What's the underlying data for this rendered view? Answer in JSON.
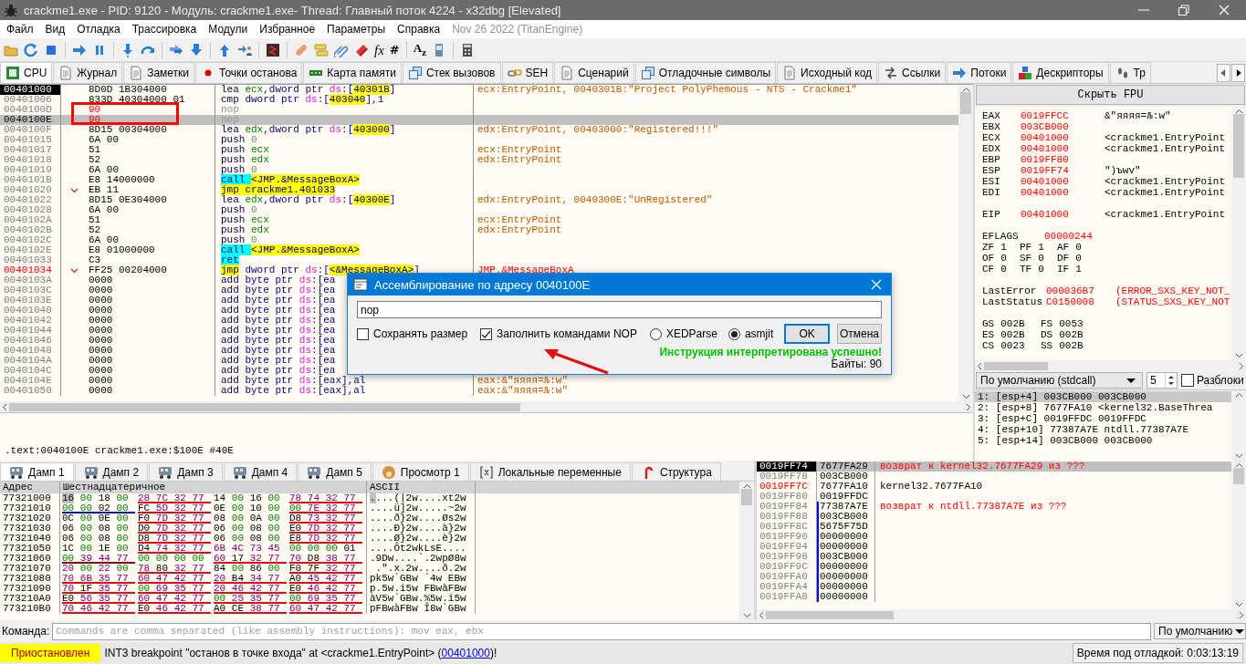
{
  "window": {
    "title": "crackme1.exe - PID: 9120 - Модуль: crackme1.exe- Thread: Главный поток 4224 - x32dbg [Elevated]"
  },
  "menu": {
    "items": [
      "Файл",
      "Вид",
      "Отладка",
      "Трассировка",
      "Модули",
      "Избранное",
      "Параметры",
      "Справка"
    ],
    "build_info": "Nov 26 2022 (TitanEngine)"
  },
  "toolbar": {
    "glyphs": [
      "fx",
      "#",
      "A$_{z}$"
    ]
  },
  "tabs": [
    {
      "label": "CPU",
      "selected": true
    },
    {
      "label": "Журнал",
      "selected": false
    },
    {
      "label": "Заметки",
      "selected": false
    },
    {
      "label": "Точки останова",
      "selected": false
    },
    {
      "label": "Карта памяти",
      "selected": false
    },
    {
      "label": "Стек вызовов",
      "selected": false
    },
    {
      "label": "SEH",
      "selected": false
    },
    {
      "label": "Сценарий",
      "selected": false
    },
    {
      "label": "Отладочные символы",
      "selected": false
    },
    {
      "label": "Исходный код",
      "selected": false
    },
    {
      "label": "Ссылки",
      "selected": false
    },
    {
      "label": "Потоки",
      "selected": false
    },
    {
      "label": "Дескрипторы",
      "selected": false
    },
    {
      "label": "Тр",
      "selected": false
    }
  ],
  "disasm": {
    "rows": [
      {
        "address": {
          "text": "00401000",
          "kind": "eip"
        },
        "jump": false,
        "bytes": "8D0D 1B304000",
        "bytes_modified": false,
        "selected": false,
        "instruction": [
          {
            "kind": "op",
            "text": "lea "
          },
          {
            "kind": "reg",
            "text": "ecx"
          },
          {
            "kind": "txt",
            "text": ",dword ptr "
          },
          {
            "kind": "seg",
            "text": "ds"
          },
          {
            "kind": "txt",
            "text": ":["
          },
          {
            "kind": "mem",
            "text": "40301B"
          },
          {
            "kind": "txt",
            "text": "]"
          }
        ],
        "comment": {
          "text": "ecx:EntryPoint, 0040301B:\"Project PolyPhemous - NTS - Crackme1\"",
          "kind": "auto"
        }
      },
      {
        "address": {
          "text": "00401006",
          "kind": "plain"
        },
        "jump": false,
        "bytes": "833D 40304000 01",
        "bytes_modified": false,
        "selected": false,
        "instruction": [
          {
            "kind": "op",
            "text": "cmp "
          },
          {
            "kind": "txt",
            "text": "dword ptr "
          },
          {
            "kind": "seg",
            "text": "ds"
          },
          {
            "kind": "txt",
            "text": ":["
          },
          {
            "kind": "mem",
            "text": "403040"
          },
          {
            "kind": "txt",
            "text": "],1"
          }
        ]
      },
      {
        "address": {
          "text": "0040100D",
          "kind": "plain"
        },
        "jump": false,
        "bytes": "90",
        "bytes_modified": true,
        "selected": false,
        "instruction": [
          {
            "kind": "dim",
            "text": "nop"
          }
        ]
      },
      {
        "address": {
          "text": "0040100E",
          "kind": "plain"
        },
        "jump": false,
        "bytes": "90",
        "bytes_modified": true,
        "selected": true,
        "instruction": [
          {
            "kind": "dim",
            "text": "nop"
          }
        ]
      },
      {
        "address": {
          "text": "0040100F",
          "kind": "plain"
        },
        "jump": false,
        "bytes": "8D15 00304000",
        "bytes_modified": false,
        "selected": false,
        "instruction": [
          {
            "kind": "op",
            "text": "lea "
          },
          {
            "kind": "reg",
            "text": "edx"
          },
          {
            "kind": "txt",
            "text": ",dword ptr "
          },
          {
            "kind": "seg",
            "text": "ds"
          },
          {
            "kind": "txt",
            "text": ":["
          },
          {
            "kind": "mem",
            "text": "403000"
          },
          {
            "kind": "txt",
            "text": "]"
          }
        ],
        "comment": {
          "text": "edx:EntryPoint, 00403000:\"Registered!!!\"",
          "kind": "auto"
        }
      },
      {
        "address": {
          "text": "00401015",
          "kind": "plain"
        },
        "jump": false,
        "bytes": "6A 00",
        "bytes_modified": false,
        "selected": false,
        "instruction": [
          {
            "kind": "op",
            "text": "push "
          },
          {
            "kind": "num",
            "text": "0"
          }
        ]
      },
      {
        "address": {
          "text": "00401017",
          "kind": "plain"
        },
        "jump": false,
        "bytes": "51",
        "bytes_modified": false,
        "selected": false,
        "instruction": [
          {
            "kind": "op",
            "text": "push "
          },
          {
            "kind": "reg",
            "text": "ecx"
          }
        ],
        "comment": {
          "text": "ecx:EntryPoint",
          "kind": "auto"
        }
      },
      {
        "address": {
          "text": "00401018",
          "kind": "plain"
        },
        "jump": false,
        "bytes": "52",
        "bytes_modified": false,
        "selected": false,
        "instruction": [
          {
            "kind": "op",
            "text": "push "
          },
          {
            "kind": "reg",
            "text": "edx"
          }
        ],
        "comment": {
          "text": "edx:EntryPoint",
          "kind": "auto"
        }
      },
      {
        "address": {
          "text": "00401019",
          "kind": "plain"
        },
        "jump": false,
        "bytes": "6A 00",
        "bytes_modified": false,
        "selected": false,
        "instruction": [
          {
            "kind": "op",
            "text": "push "
          },
          {
            "kind": "num",
            "text": "0"
          }
        ]
      },
      {
        "address": {
          "text": "0040101B",
          "kind": "plain"
        },
        "jump": false,
        "bytes": "E8 14000000",
        "bytes_modified": false,
        "selected": false,
        "instruction": [
          {
            "kind": "call",
            "text": "call "
          },
          {
            "kind": "sym",
            "text": "<JMP.&MessageBoxA>"
          }
        ]
      },
      {
        "address": {
          "text": "00401020",
          "kind": "plain"
        },
        "jump": true,
        "bytes": "EB 11",
        "bytes_modified": false,
        "selected": false,
        "instruction": [
          {
            "kind": "jmp",
            "text": "jmp "
          },
          {
            "kind": "sym",
            "text": "crackme1.401033"
          }
        ]
      },
      {
        "address": {
          "text": "00401022",
          "kind": "plain"
        },
        "jump": false,
        "bytes": "8D15 0E304000",
        "bytes_modified": false,
        "selected": false,
        "instruction": [
          {
            "kind": "op",
            "text": "lea "
          },
          {
            "kind": "reg",
            "text": "edx"
          },
          {
            "kind": "txt",
            "text": ",dword ptr "
          },
          {
            "kind": "seg",
            "text": "ds"
          },
          {
            "kind": "txt",
            "text": ":["
          },
          {
            "kind": "mem",
            "text": "40300E"
          },
          {
            "kind": "txt",
            "text": "]"
          }
        ],
        "comment": {
          "text": "edx:EntryPoint, 0040300E:\"UnRegistered\"",
          "kind": "auto"
        }
      },
      {
        "address": {
          "text": "00401028",
          "kind": "plain"
        },
        "jump": false,
        "bytes": "6A 00",
        "bytes_modified": false,
        "selected": false,
        "instruction": [
          {
            "kind": "op",
            "text": "push "
          },
          {
            "kind": "num",
            "text": "0"
          }
        ]
      },
      {
        "address": {
          "text": "0040102A",
          "kind": "plain"
        },
        "jump": false,
        "bytes": "51",
        "bytes_modified": false,
        "selected": false,
        "instruction": [
          {
            "kind": "op",
            "text": "push "
          },
          {
            "kind": "reg",
            "text": "ecx"
          }
        ],
        "comment": {
          "text": "ecx:EntryPoint",
          "kind": "auto"
        }
      },
      {
        "address": {
          "text": "0040102B",
          "kind": "plain"
        },
        "jump": false,
        "bytes": "52",
        "bytes_modified": false,
        "selected": false,
        "instruction": [
          {
            "kind": "op",
            "text": "push "
          },
          {
            "kind": "reg",
            "text": "edx"
          }
        ],
        "comment": {
          "text": "edx:EntryPoint",
          "kind": "auto"
        }
      },
      {
        "address": {
          "text": "0040102C",
          "kind": "plain"
        },
        "jump": false,
        "bytes": "6A 00",
        "bytes_modified": false,
        "selected": false,
        "instruction": [
          {
            "kind": "op",
            "text": "push "
          },
          {
            "kind": "num",
            "text": "0"
          }
        ]
      },
      {
        "address": {
          "text": "0040102E",
          "kind": "plain"
        },
        "jump": false,
        "bytes": "E8 01000000",
        "bytes_modified": false,
        "selected": false,
        "instruction": [
          {
            "kind": "call",
            "text": "call "
          },
          {
            "kind": "sym",
            "text": "<JMP.&MessageBoxA>"
          }
        ]
      },
      {
        "address": {
          "text": "00401033",
          "kind": "plain"
        },
        "jump": false,
        "bytes": "C3",
        "bytes_modified": false,
        "selected": false,
        "instruction": [
          {
            "kind": "call",
            "text": "ret"
          }
        ]
      },
      {
        "address": {
          "text": "00401034",
          "kind": "label"
        },
        "jump": true,
        "bytes": "FF25 00204000",
        "bytes_modified": false,
        "selected": false,
        "instruction": [
          {
            "kind": "jmp",
            "text": "jmp"
          },
          {
            "kind": "txt",
            "text": " dword ptr "
          },
          {
            "kind": "seg",
            "text": "ds"
          },
          {
            "kind": "txt",
            "text": ":["
          },
          {
            "kind": "sym",
            "text": "<&MessageBoxA>"
          },
          {
            "kind": "txt",
            "text": "]"
          }
        ],
        "comment": {
          "text": "JMP.&MessageBoxA",
          "kind": "label"
        }
      },
      {
        "address": {
          "text": "0040103A",
          "kind": "plain"
        },
        "jump": false,
        "bytes": "0000",
        "bytes_modified": false,
        "selected": false,
        "instruction": [
          {
            "kind": "op",
            "text": "add "
          },
          {
            "kind": "txt",
            "text": "byte ptr "
          },
          {
            "kind": "seg",
            "text": "ds"
          },
          {
            "kind": "txt",
            "text": ":[ea"
          }
        ]
      },
      {
        "address": {
          "text": "0040103C",
          "kind": "plain"
        },
        "jump": false,
        "bytes": "0000",
        "bytes_modified": false,
        "selected": false,
        "instruction": [
          {
            "kind": "op",
            "text": "add "
          },
          {
            "kind": "txt",
            "text": "byte ptr "
          },
          {
            "kind": "seg",
            "text": "ds"
          },
          {
            "kind": "txt",
            "text": ":[ea"
          }
        ]
      },
      {
        "address": {
          "text": "0040103E",
          "kind": "plain"
        },
        "jump": false,
        "bytes": "0000",
        "bytes_modified": false,
        "selected": false,
        "instruction": [
          {
            "kind": "op",
            "text": "add "
          },
          {
            "kind": "txt",
            "text": "byte ptr "
          },
          {
            "kind": "seg",
            "text": "ds"
          },
          {
            "kind": "txt",
            "text": ":[ea"
          }
        ]
      },
      {
        "address": {
          "text": "00401040",
          "kind": "plain"
        },
        "jump": false,
        "bytes": "0000",
        "bytes_modified": false,
        "selected": false,
        "instruction": [
          {
            "kind": "op",
            "text": "add "
          },
          {
            "kind": "txt",
            "text": "byte ptr "
          },
          {
            "kind": "seg",
            "text": "ds"
          },
          {
            "kind": "txt",
            "text": ":[ea"
          }
        ]
      },
      {
        "address": {
          "text": "00401042",
          "kind": "plain"
        },
        "jump": false,
        "bytes": "0000",
        "bytes_modified": false,
        "selected": false,
        "instruction": [
          {
            "kind": "op",
            "text": "add "
          },
          {
            "kind": "txt",
            "text": "byte ptr "
          },
          {
            "kind": "seg",
            "text": "ds"
          },
          {
            "kind": "txt",
            "text": ":[ea"
          }
        ]
      },
      {
        "address": {
          "text": "00401044",
          "kind": "plain"
        },
        "jump": false,
        "bytes": "0000",
        "bytes_modified": false,
        "selected": false,
        "instruction": [
          {
            "kind": "op",
            "text": "add "
          },
          {
            "kind": "txt",
            "text": "byte ptr "
          },
          {
            "kind": "seg",
            "text": "ds"
          },
          {
            "kind": "txt",
            "text": ":[ea"
          }
        ]
      },
      {
        "address": {
          "text": "00401046",
          "kind": "plain"
        },
        "jump": false,
        "bytes": "0000",
        "bytes_modified": false,
        "selected": false,
        "instruction": [
          {
            "kind": "op",
            "text": "add "
          },
          {
            "kind": "txt",
            "text": "byte ptr "
          },
          {
            "kind": "seg",
            "text": "ds"
          },
          {
            "kind": "txt",
            "text": ":[ea"
          }
        ]
      },
      {
        "address": {
          "text": "00401048",
          "kind": "plain"
        },
        "jump": false,
        "bytes": "0000",
        "bytes_modified": false,
        "selected": false,
        "instruction": [
          {
            "kind": "op",
            "text": "add "
          },
          {
            "kind": "txt",
            "text": "byte ptr "
          },
          {
            "kind": "seg",
            "text": "ds"
          },
          {
            "kind": "txt",
            "text": ":[ea"
          }
        ]
      },
      {
        "address": {
          "text": "0040104A",
          "kind": "plain"
        },
        "jump": false,
        "bytes": "0000",
        "bytes_modified": false,
        "selected": false,
        "instruction": [
          {
            "kind": "op",
            "text": "add "
          },
          {
            "kind": "txt",
            "text": "byte ptr "
          },
          {
            "kind": "seg",
            "text": "ds"
          },
          {
            "kind": "txt",
            "text": ":[ea"
          }
        ]
      },
      {
        "address": {
          "text": "0040104C",
          "kind": "plain"
        },
        "jump": false,
        "bytes": "0000",
        "bytes_modified": false,
        "selected": false,
        "instruction": [
          {
            "kind": "op",
            "text": "add "
          },
          {
            "kind": "txt",
            "text": "byte ptr "
          },
          {
            "kind": "seg",
            "text": "ds"
          },
          {
            "kind": "txt",
            "text": ":[ea"
          }
        ]
      },
      {
        "address": {
          "text": "0040104E",
          "kind": "plain"
        },
        "jump": false,
        "bytes": "0000",
        "bytes_modified": false,
        "selected": false,
        "instruction": [
          {
            "kind": "op",
            "text": "add "
          },
          {
            "kind": "txt",
            "text": "byte ptr "
          },
          {
            "kind": "seg",
            "text": "ds"
          },
          {
            "kind": "txt",
            "text": ":[eax],al"
          }
        ],
        "comment": {
          "text": "eax:&\"яяяя=Љ:w\"",
          "kind": "auto"
        }
      },
      {
        "address": {
          "text": "00401050",
          "kind": "plain"
        },
        "jump": false,
        "bytes": "0000",
        "bytes_modified": false,
        "selected": false,
        "instruction": [
          {
            "kind": "op",
            "text": "add "
          },
          {
            "kind": "txt",
            "text": "byte ptr "
          },
          {
            "kind": "seg",
            "text": "ds"
          },
          {
            "kind": "txt",
            "text": ":[eax],al"
          }
        ],
        "comment": {
          "text": "eax:&\"яяяя=Љ:w\"",
          "kind": "auto"
        }
      }
    ],
    "info": ".text:0040100E crackme1.exe:$100E #40E"
  },
  "dialog": {
    "title": "Ассемблирование по адресу 0040100E",
    "value": "nop",
    "checkboxes": [
      {
        "label": "Сохранять размер",
        "checked": false
      },
      {
        "label": "Заполнить командами NOP",
        "checked": true
      }
    ],
    "radios": [
      {
        "label": "XEDParse",
        "selected": false
      },
      {
        "label": "asmjit",
        "selected": true
      }
    ],
    "buttons": [
      {
        "label": "OK",
        "default": true
      },
      {
        "label": "Отмена",
        "default": false
      }
    ],
    "status": "Инструкция интерпретирована успешно!",
    "bytes": "Байты: 90"
  },
  "annotations": {
    "frame": true,
    "arrow": true
  },
  "registers": {
    "button": "Скрыть FPU",
    "groups": [
      [
        {
          "kind": "reg",
          "name": "EAX",
          "value": "0019FFCC",
          "info": "&\"яяяя=Љ:w\""
        },
        {
          "kind": "reg",
          "name": "EBX",
          "value": "003CB000"
        },
        {
          "kind": "reg",
          "name": "ECX",
          "value": "00401000",
          "info": "<crackme1.EntryPoint"
        },
        {
          "kind": "reg",
          "name": "EDX",
          "value": "00401000",
          "info": "<crackme1.EntryPoint"
        },
        {
          "kind": "reg",
          "name": "EBP",
          "value": "0019FF80"
        },
        {
          "kind": "reg",
          "name": "ESP",
          "value": "0019FF74",
          "info": "\")ъwv\""
        },
        {
          "kind": "reg",
          "name": "ESI",
          "value": "00401000",
          "info": "<crackme1.EntryPoint"
        },
        {
          "kind": "reg",
          "name": "EDI",
          "value": "00401000",
          "info": "<crackme1.EntryPoint"
        }
      ],
      [
        {
          "kind": "reg",
          "name": "EIP",
          "value": "00401000",
          "info": "<crackme1.EntryPoint"
        }
      ],
      [
        {
          "kind": "eflags",
          "name": "EFLAGS",
          "value": "00000244"
        },
        {
          "kind": "flags",
          "items": [
            {
              "name": "ZF",
              "value": "1"
            },
            {
              "name": "PF",
              "value": "1"
            },
            {
              "name": "AF",
              "value": "0"
            }
          ]
        },
        {
          "kind": "flags",
          "items": [
            {
              "name": "OF",
              "value": "0"
            },
            {
              "name": "SF",
              "value": "0"
            },
            {
              "name": "DF",
              "value": "0"
            }
          ]
        },
        {
          "kind": "flags",
          "items": [
            {
              "name": "CF",
              "value": "0"
            },
            {
              "name": "TF",
              "value": "0"
            },
            {
              "name": "IF",
              "value": "1"
            }
          ]
        }
      ],
      [
        {
          "kind": "error",
          "name": "LastError",
          "value": "000036B7",
          "info": "(ERROR_SXS_KEY_NOT_"
        },
        {
          "kind": "error",
          "name": "LastStatus",
          "value": "C0150008",
          "info": "(STATUS_SXS_KEY_NOT"
        }
      ],
      [
        {
          "kind": "segments",
          "items": [
            {
              "name": "GS",
              "value": "002B"
            },
            {
              "name": "FS",
              "value": "0053"
            }
          ]
        },
        {
          "kind": "segments",
          "items": [
            {
              "name": "ES",
              "value": "002B"
            },
            {
              "name": "DS",
              "value": "002B"
            }
          ]
        },
        {
          "kind": "segments",
          "items": [
            {
              "name": "CS",
              "value": "0023"
            },
            {
              "name": "SS",
              "value": "002B"
            }
          ]
        }
      ]
    ]
  },
  "call_args": {
    "convention": "По умолчанию (stdcall)",
    "count": "5",
    "unlock": {
      "label": "Разблоки",
      "checked": false
    },
    "lines": [
      {
        "text": "1: [esp+4] 003CB000 003CB000",
        "selected": true
      },
      {
        "text": "2: [esp+8] 7677FA10 <kernel32.BaseThrea",
        "selected": false
      },
      {
        "text": "3: [esp+C] 0019FFDC 0019FFDC",
        "selected": false
      },
      {
        "text": "4: [esp+10] 77387A7E ntdll.77387A7E",
        "selected": false
      },
      {
        "text": "5: [esp+14] 003CB000 003CB000",
        "selected": false
      }
    ]
  },
  "dump_tabs": [
    {
      "label": "Дамп 1",
      "selected": true
    },
    {
      "label": "Дамп 2",
      "selected": false
    },
    {
      "label": "Дамп 3",
      "selected": false
    },
    {
      "label": "Дамп 4",
      "selected": false
    },
    {
      "label": "Дамп 5",
      "selected": false
    },
    {
      "label": "Просмотр 1",
      "selected": false
    },
    {
      "label": "Локальные переменные",
      "selected": false
    },
    {
      "label": "Структура",
      "selected": false
    }
  ],
  "dump": {
    "columns": [
      "Адрес",
      "Шестнадцатеричное",
      "ASCII"
    ],
    "rows": [
      {
        "address": "77321000",
        "cursor": true,
        "groups": [
          {
            "bytes": "16 00 18 00"
          },
          {
            "bytes": "28 7C 32 77",
            "color": "#e01010"
          },
          {
            "bytes": "14 00 16 00"
          },
          {
            "bytes": "78 74 32 77",
            "color": "#e01010"
          }
        ],
        "ascii": "....(|2w....xt2w"
      },
      {
        "address": "77321010",
        "cursor": false,
        "groups": [
          {
            "bytes": "00 00 02 00",
            "color": "#1010c0"
          },
          {
            "bytes": "FC 5D 32 77",
            "color": "#e01010"
          },
          {
            "bytes": "0E 00 10 00"
          },
          {
            "bytes": "00 7E 32 77",
            "color": "#e01010"
          }
        ],
        "ascii": "....ü]2w.....~2w"
      },
      {
        "address": "77321020",
        "cursor": false,
        "groups": [
          {
            "bytes": "0C 00 0E 00"
          },
          {
            "bytes": "F0 7D 32 77",
            "color": "#e01010"
          },
          {
            "bytes": "08 00 0A 00"
          },
          {
            "bytes": "D8 73 32 77",
            "color": "#e01010"
          }
        ],
        "ascii": "....ð}2w....Øs2w"
      },
      {
        "address": "77321030",
        "cursor": false,
        "groups": [
          {
            "bytes": "06 00 08 00"
          },
          {
            "bytes": "D0 7D 32 77",
            "color": "#e01010"
          },
          {
            "bytes": "06 00 08 00"
          },
          {
            "bytes": "E0 7D 32 77",
            "color": "#e01010"
          }
        ],
        "ascii": "....Ð}2w....à}2w"
      },
      {
        "address": "77321040",
        "cursor": false,
        "groups": [
          {
            "bytes": "06 00 08 00"
          },
          {
            "bytes": "D8 7D 32 77",
            "color": "#e01010"
          },
          {
            "bytes": "06 00 08 00"
          },
          {
            "bytes": "E8 7D 32 77",
            "color": "#e01010"
          }
        ],
        "ascii": "....Ø}2w....è}2w"
      },
      {
        "address": "77321050",
        "cursor": false,
        "groups": [
          {
            "bytes": "1C 00 1E 00"
          },
          {
            "bytes": "D4 74 32 77",
            "color": "#e01010"
          },
          {
            "bytes": "6B 4C 73 45"
          },
          {
            "bytes": "00 00 00 01"
          }
        ],
        "ascii": "....Ôt2wkLsE...."
      },
      {
        "address": "77321060",
        "cursor": false,
        "groups": [
          {
            "bytes": "00 39 44 77",
            "color": "#801010"
          },
          {
            "bytes": "00 00 00 00"
          },
          {
            "bytes": "60 17 32 77",
            "color": "#e01010"
          },
          {
            "bytes": "70 D8 38 77",
            "color": "#e01010"
          }
        ],
        "ascii": ".9Dw....`.2wpØ8w"
      },
      {
        "address": "77321070",
        "cursor": false,
        "groups": [
          {
            "bytes": "20 00 22 00"
          },
          {
            "bytes": "78 80 32 77",
            "color": "#e01010"
          },
          {
            "bytes": "84 00 86 00"
          },
          {
            "bytes": "F0 7F 32 77",
            "color": "#e01010"
          }
        ],
        "ascii": " .\".x.2w....ð.2w"
      },
      {
        "address": "77321080",
        "cursor": false,
        "groups": [
          {
            "bytes": "70 6B 35 77",
            "color": "#e01010"
          },
          {
            "bytes": "60 47 42 77",
            "color": "#e01010"
          },
          {
            "bytes": "20 B4 34 77",
            "color": "#e01010"
          },
          {
            "bytes": "A0 45 42 77",
            "color": "#e01010"
          }
        ],
        "ascii": "pk5w`GBw ´4w EBw"
      },
      {
        "address": "77321090",
        "cursor": false,
        "groups": [
          {
            "bytes": "70 1F 35 77",
            "color": "#e01010"
          },
          {
            "bytes": "00 69 35 77",
            "color": "#e01010"
          },
          {
            "bytes": "20 46 42 77",
            "color": "#e01010"
          },
          {
            "bytes": "E0 46 42 77",
            "color": "#e01010"
          }
        ],
        "ascii": "p.5w.i5w FBwàFBw"
      },
      {
        "address": "773210A0",
        "cursor": false,
        "groups": [
          {
            "bytes": "E0 56 35 77",
            "color": "#e01010"
          },
          {
            "bytes": "60 47 42 77",
            "color": "#e01010"
          },
          {
            "bytes": "00 25 35 77",
            "color": "#e01010"
          },
          {
            "bytes": "00 69 35 77",
            "color": "#e01010"
          }
        ],
        "ascii": "àV5w`GBw.%5w.i5w"
      },
      {
        "address": "773210B0",
        "cursor": false,
        "groups": [
          {
            "bytes": "70 46 42 77",
            "color": "#e01010"
          },
          {
            "bytes": "E0 46 42 77",
            "color": "#e01010"
          },
          {
            "bytes": "A0 CE 38 77",
            "color": "#e01010"
          },
          {
            "bytes": "60 47 42 77",
            "color": "#e01010"
          }
        ],
        "ascii": "pFBwàFBw Î8w`GBw"
      }
    ]
  },
  "stack": {
    "rows": [
      {
        "address": {
          "text": "0019FF74",
          "kind": "esp"
        },
        "value": "7677FA29",
        "comment": {
          "text": "возврат к kernel32.7677FA29 из ???",
          "kind": "return"
        },
        "selected": true,
        "in_frame": false
      },
      {
        "address": {
          "text": "0019FF78",
          "kind": "plain"
        },
        "value": "003CB000",
        "selected": false,
        "in_frame": false
      },
      {
        "address": {
          "text": "0019FF7C",
          "kind": "label"
        },
        "value": "7677FA10",
        "comment": {
          "text": "kernel32.7677FA10",
          "kind": "plain"
        },
        "selected": false,
        "in_frame": false
      },
      {
        "address": {
          "text": "0019FF80",
          "kind": "plain"
        },
        "value": "0019FFDC",
        "selected": false,
        "in_frame": false
      },
      {
        "address": {
          "text": "0019FF84",
          "kind": "plain"
        },
        "value": "77387A7E",
        "comment": {
          "text": "возврат к ntdll.77387A7E из ???",
          "kind": "return"
        },
        "selected": false,
        "in_frame": true
      },
      {
        "address": {
          "text": "0019FF88",
          "kind": "plain"
        },
        "value": "003CB000",
        "selected": false,
        "in_frame": true
      },
      {
        "address": {
          "text": "0019FF8C",
          "kind": "plain"
        },
        "value": "5675F75D",
        "selected": false,
        "in_frame": true
      },
      {
        "address": {
          "text": "0019FF90",
          "kind": "plain"
        },
        "value": "00000000",
        "selected": false,
        "in_frame": true
      },
      {
        "address": {
          "text": "0019FF94",
          "kind": "plain"
        },
        "value": "00000000",
        "selected": false,
        "in_frame": true
      },
      {
        "address": {
          "text": "0019FF98",
          "kind": "plain"
        },
        "value": "003CB000",
        "selected": false,
        "in_frame": true
      },
      {
        "address": {
          "text": "0019FF9C",
          "kind": "plain"
        },
        "value": "00000000",
        "selected": false,
        "in_frame": true
      },
      {
        "address": {
          "text": "0019FFA0",
          "kind": "plain"
        },
        "value": "00000000",
        "selected": false,
        "in_frame": true
      },
      {
        "address": {
          "text": "0019FFA4",
          "kind": "plain"
        },
        "value": "00000000",
        "selected": false,
        "in_frame": true
      },
      {
        "address": {
          "text": "0019FFA8",
          "kind": "plain"
        },
        "value": "00000000",
        "selected": false,
        "in_frame": true
      }
    ]
  },
  "command": {
    "label": "Команда:",
    "placeholder": "Commands are comma separated (like assembly instructions): mov eax, ebx",
    "mode": "По умолчанию"
  },
  "status_bar": {
    "state": "Приостановлен",
    "text_before": "INT3 breakpoint \"останов в точке входа\" at <crackme1.EntryPoint> (",
    "link": "00401000",
    "text_after": ")!",
    "time": "Время под отладкой: 0:03:13:19"
  }
}
